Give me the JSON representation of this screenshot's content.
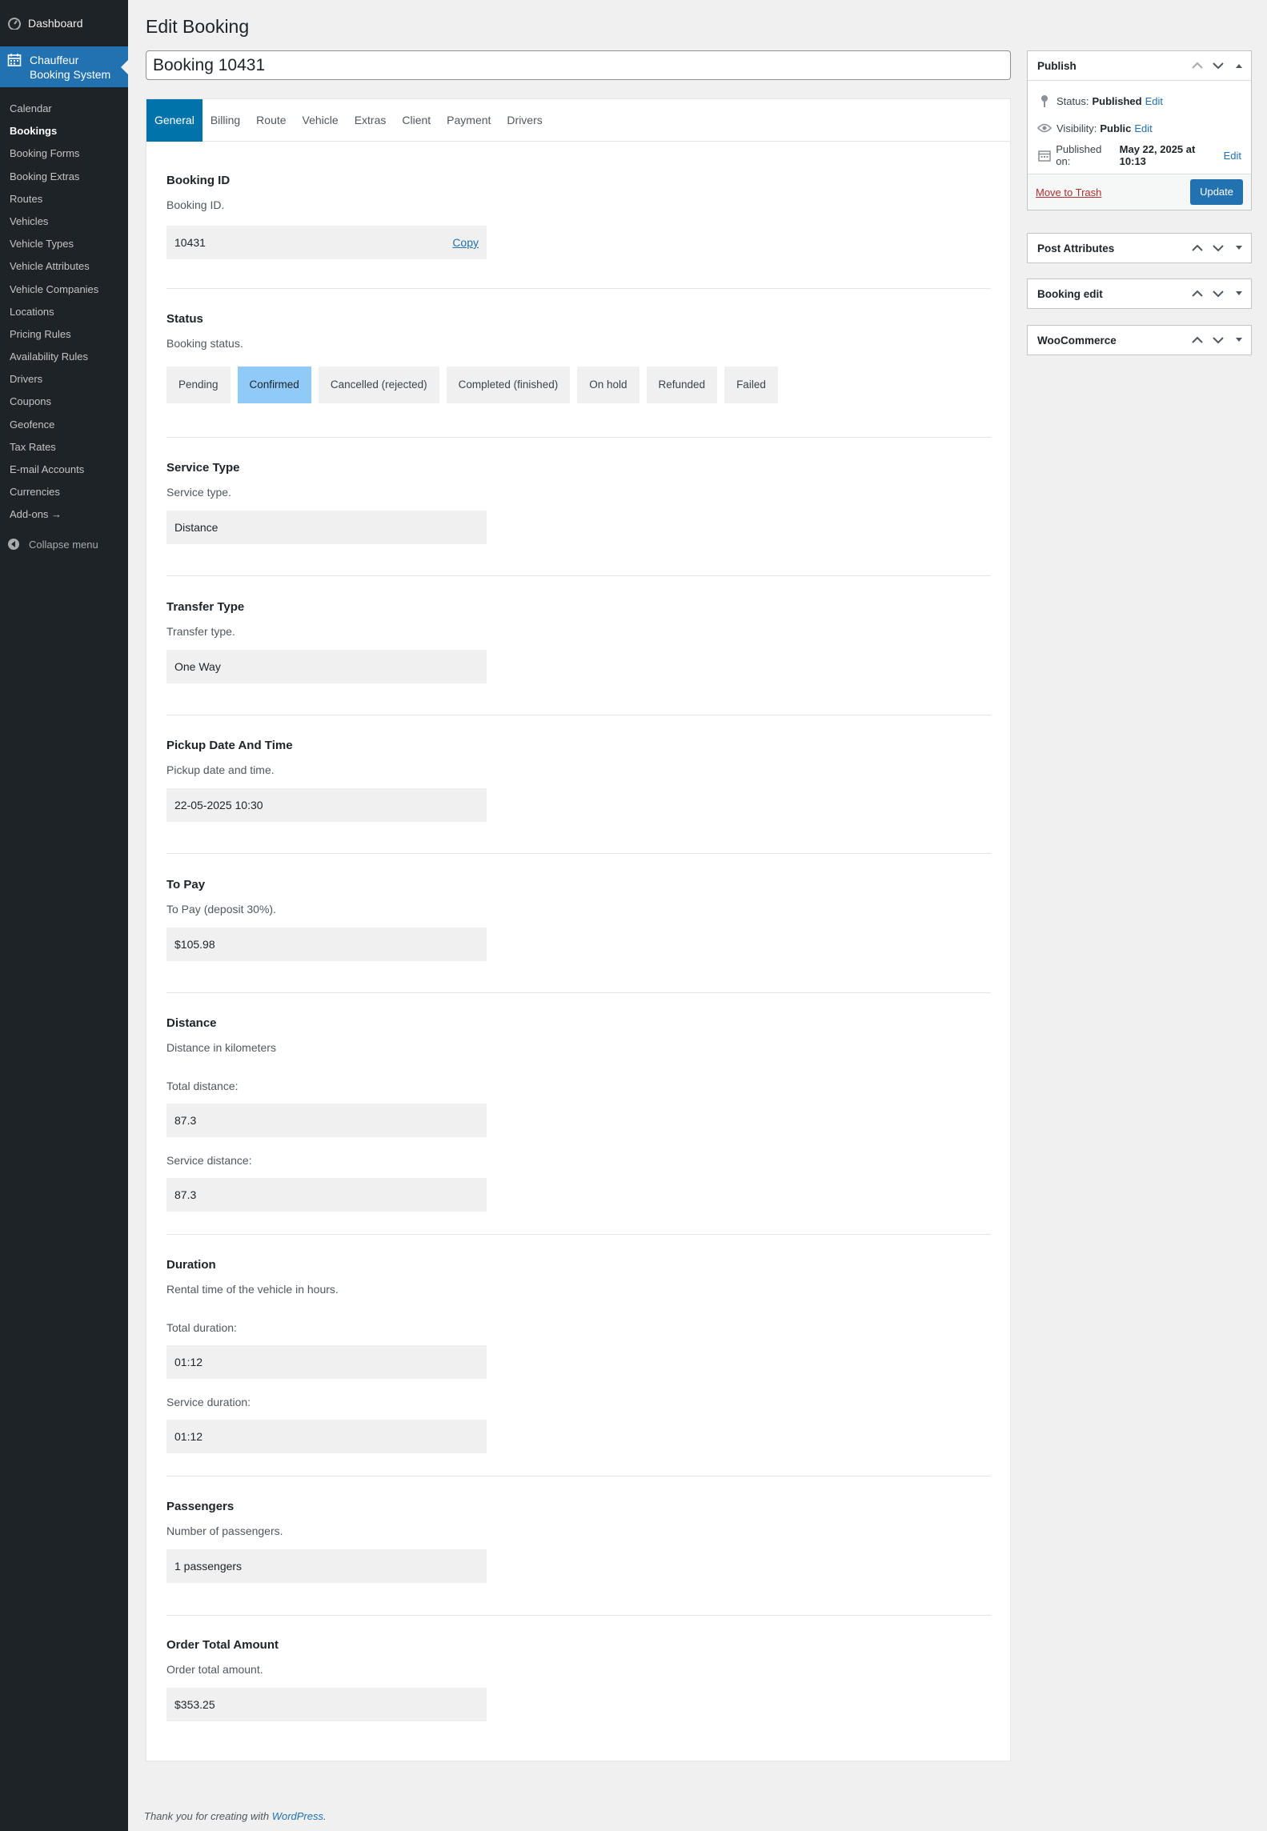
{
  "sidebar": {
    "dashboard": "Dashboard",
    "current_menu": "Chauffeur Booking System",
    "items": [
      "Calendar",
      "Bookings",
      "Booking Forms",
      "Booking Extras",
      "Routes",
      "Vehicles",
      "Vehicle Types",
      "Vehicle Attributes",
      "Vehicle Companies",
      "Locations",
      "Pricing Rules",
      "Availability Rules",
      "Drivers",
      "Coupons",
      "Geofence",
      "Tax Rates",
      "E-mail Accounts",
      "Currencies",
      "Add-ons →"
    ],
    "active_item": "Bookings",
    "collapse": "Collapse menu"
  },
  "page": {
    "title": "Edit Booking",
    "post_title": "Booking 10431"
  },
  "tabs": [
    "General",
    "Billing",
    "Route",
    "Vehicle",
    "Extras",
    "Client",
    "Payment",
    "Drivers"
  ],
  "active_tab": "General",
  "fields": {
    "booking_id": {
      "title": "Booking ID",
      "desc": "Booking ID.",
      "value": "10431",
      "copy": "Copy"
    },
    "status": {
      "title": "Status",
      "desc": "Booking status.",
      "options": [
        "Pending",
        "Confirmed",
        "Cancelled (rejected)",
        "Completed (finished)",
        "On hold",
        "Refunded",
        "Failed"
      ],
      "selected": "Confirmed"
    },
    "service_type": {
      "title": "Service Type",
      "desc": "Service type.",
      "value": "Distance"
    },
    "transfer_type": {
      "title": "Transfer Type",
      "desc": "Transfer type.",
      "value": "One Way"
    },
    "pickup": {
      "title": "Pickup Date And Time",
      "desc": "Pickup date and time.",
      "value": "22-05-2025 10:30"
    },
    "to_pay": {
      "title": "To Pay",
      "desc": "To Pay (deposit 30%).",
      "value": "$105.98"
    },
    "distance": {
      "title": "Distance",
      "desc": "Distance in kilometers",
      "total_label": "Total distance:",
      "total_value": "87.3",
      "service_label": "Service distance:",
      "service_value": "87.3"
    },
    "duration": {
      "title": "Duration",
      "desc": "Rental time of the vehicle in hours.",
      "total_label": "Total duration:",
      "total_value": "01:12",
      "service_label": "Service duration:",
      "service_value": "01:12"
    },
    "passengers": {
      "title": "Passengers",
      "desc": "Number of passengers.",
      "value": "1 passengers"
    },
    "order_total": {
      "title": "Order Total Amount",
      "desc": "Order total amount.",
      "value": "$353.25"
    }
  },
  "publish": {
    "title": "Publish",
    "status_label": "Status:",
    "status_value": "Published",
    "visibility_label": "Visibility:",
    "visibility_value": "Public",
    "published_label": "Published on:",
    "published_value": "May 22, 2025 at 10:13",
    "edit": "Edit",
    "trash": "Move to Trash",
    "update": "Update"
  },
  "boxes": [
    "Post Attributes",
    "Booking edit",
    "WooCommerce"
  ],
  "footer": {
    "text": "Thank you for creating with ",
    "link": "WordPress",
    "end": "."
  },
  "colors": {
    "sidebar": "#1d2327",
    "accent": "#2271b1",
    "tab_active": "#0073aa",
    "status_selected": "#90caf9"
  }
}
